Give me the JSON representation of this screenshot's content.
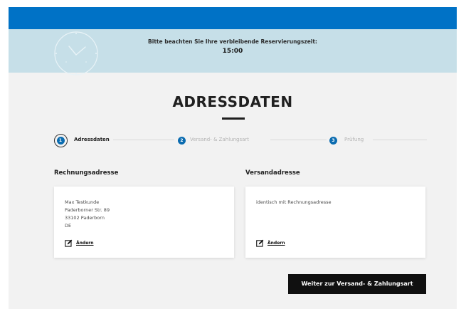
{
  "timer": {
    "label": "Bitte beachten Sie Ihre verbleibende Reservierungszeit:",
    "value": "15:00"
  },
  "page": {
    "title": "ADRESSDATEN"
  },
  "steps": [
    {
      "number": "1",
      "label": "Adressdaten",
      "state": "active"
    },
    {
      "number": "2",
      "label": "Versand- & Zahlungsart",
      "state": "inactive"
    },
    {
      "number": "3",
      "label": "Prüfung",
      "state": "inactive"
    }
  ],
  "billing": {
    "heading": "Rechnungsadresse",
    "lines": [
      "Max Testkunde",
      "Paderborner Str. 89",
      "33102 Paderborn",
      "DE"
    ],
    "change_label": "Ändern"
  },
  "shipping": {
    "heading": "Versandadresse",
    "text": "identisch mit Rechnungsadresse",
    "change_label": "Ändern"
  },
  "cta": {
    "label": "Weiter zur Versand- & Zahlungsart"
  },
  "colors": {
    "topbar": "#0072c6",
    "timer_bar": "#c6dfe8",
    "step_badge": "#0b6cb0",
    "cta_bg": "#101010",
    "page_bg": "#f2f2f2"
  },
  "icons": {
    "clock": "clock-icon",
    "edit": "edit-icon"
  }
}
